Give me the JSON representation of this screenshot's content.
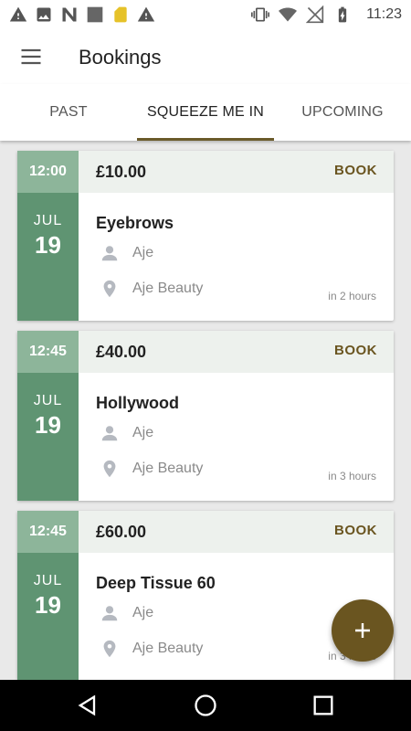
{
  "status": {
    "time": "11:23"
  },
  "header": {
    "title": "Bookings"
  },
  "tabs": [
    {
      "label": "PAST"
    },
    {
      "label": "SQUEEZE ME IN",
      "active": true
    },
    {
      "label": "UPCOMING"
    }
  ],
  "bookings": [
    {
      "time": "12:00",
      "month": "JUL",
      "day": "19",
      "price": "£10.00",
      "action": "BOOK",
      "service": "Eyebrows",
      "staff": "Aje",
      "location": "Aje Beauty",
      "eta": "in 2 hours"
    },
    {
      "time": "12:45",
      "month": "JUL",
      "day": "19",
      "price": "£40.00",
      "action": "BOOK",
      "service": "Hollywood",
      "staff": "Aje",
      "location": "Aje Beauty",
      "eta": "in 3 hours"
    },
    {
      "time": "12:45",
      "month": "JUL",
      "day": "19",
      "price": "£60.00",
      "action": "BOOK",
      "service": "Deep Tissue 60",
      "staff": "Aje",
      "location": "Aje Beauty",
      "eta": "in 3 hours"
    }
  ],
  "colors": {
    "accent": "#6a5520",
    "time_bg": "#8db59a",
    "date_bg": "#5f9472",
    "header_bg": "#edf1ed"
  }
}
